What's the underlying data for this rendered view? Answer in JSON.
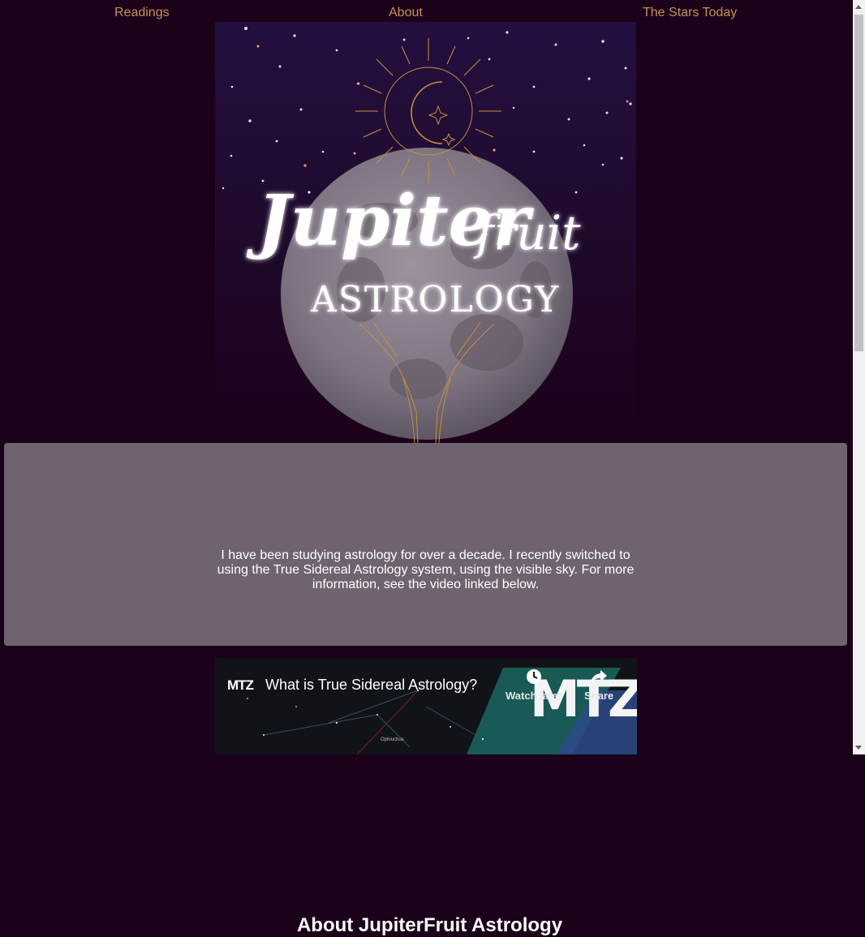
{
  "nav": {
    "items": [
      "Readings",
      "About",
      "The Stars Today"
    ]
  },
  "hero": {
    "logo_word1": "Jupiter",
    "logo_word2": "fruit",
    "logo_sub": "ASTROLOGY"
  },
  "about": {
    "title": "About JupiterFruit Astrology",
    "body": "I have been studying astrology for over a decade. I recently switched to using the True Sidereal Astrology system, using the visible sky. For more information, see the video linked below."
  },
  "video": {
    "channel_logo": "MTZ",
    "title": "What is True Sidereal Astrology?",
    "watch_later": "Watch later",
    "share": "Share",
    "brand": "MTZ",
    "caption": "Ophiuchus"
  },
  "colors": {
    "background": "#1b0119",
    "nav_link": "#c7925a",
    "card": "#6f636f",
    "text": "#ffffff"
  }
}
